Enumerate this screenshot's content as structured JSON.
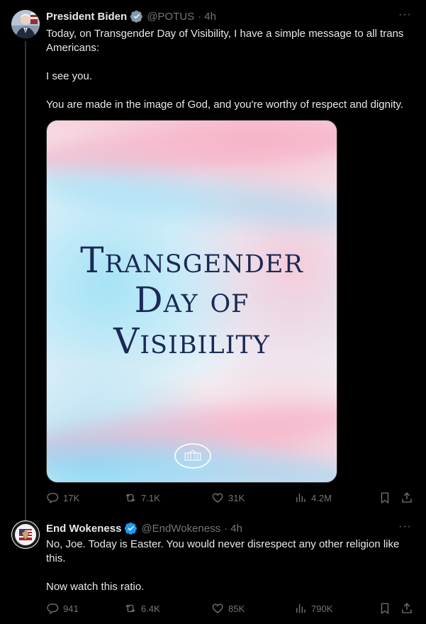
{
  "tweet1": {
    "name": "President Biden",
    "handle": "@POTUS",
    "time": "· 4h",
    "text": [
      "Today, on Transgender Day of Visibility, I have a simple message to all trans Americans:",
      "I see you.",
      "You are made in the image of God, and you're worthy of respect and dignity."
    ],
    "image_title": [
      "Transgender",
      "Day of",
      "Visibility"
    ],
    "replies": "17K",
    "reposts": "7.1K",
    "likes": "31K",
    "views": "4.2M"
  },
  "tweet2": {
    "name": "End Wokeness",
    "handle": "@EndWokeness",
    "time": "· 4h",
    "avatar_text": [
      "SUPPORT OUR",
      "BORDER PATROL"
    ],
    "text": [
      "No, Joe. Today is Easter. You would never disrespect any other religion like this.",
      "Now watch this ratio."
    ],
    "replies": "941",
    "reposts": "6.4K",
    "likes": "85K",
    "views": "790K"
  },
  "icons": {
    "more": "more-dots-icon",
    "reply": "reply-bubble-icon",
    "repost": "repost-icon",
    "like": "heart-icon",
    "views": "analytics-bars-icon",
    "bookmark": "bookmark-icon",
    "share": "share-icon",
    "verified": "verified-badge-icon"
  },
  "colors": {
    "background": "#000000",
    "text": "#e7e9ea",
    "secondary": "#71767b",
    "verified": "#1d9bf0",
    "image_title": "#1a2a55"
  }
}
